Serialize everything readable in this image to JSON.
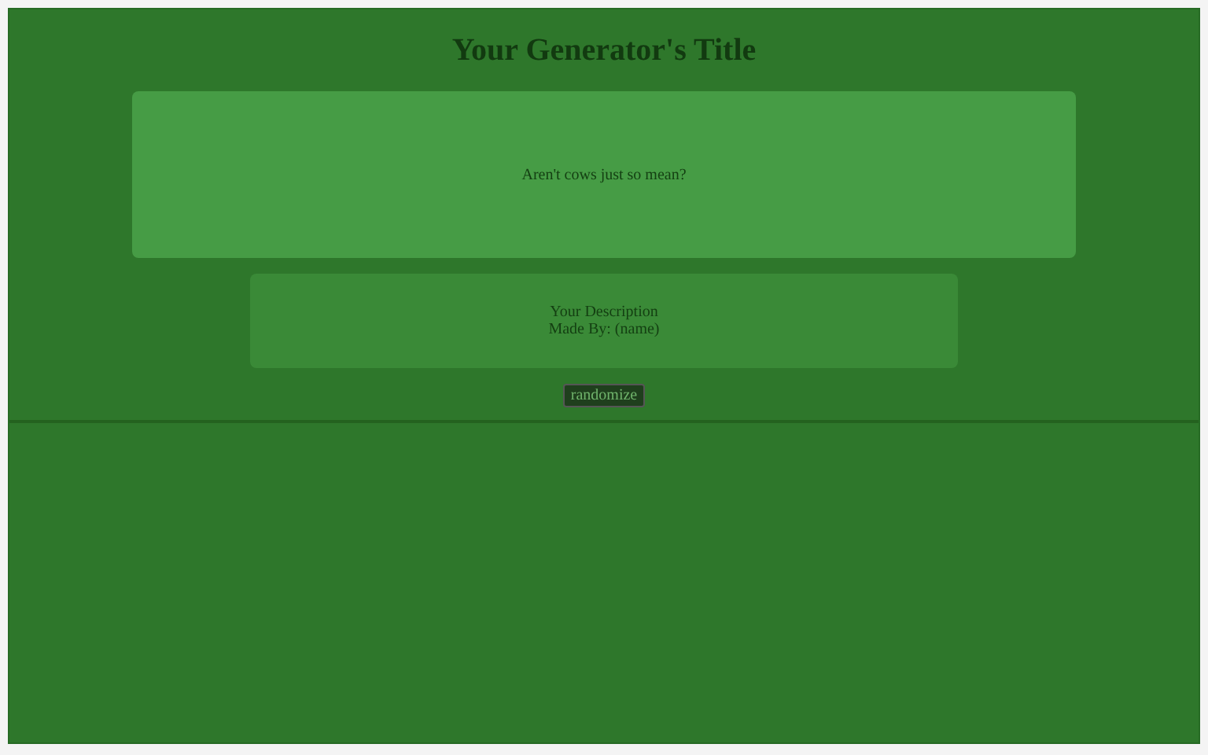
{
  "title": "Your Generator's Title",
  "output": "Aren't cows just so mean?",
  "description": [
    "Your Description",
    "Made By: (name)"
  ],
  "button": "randomize"
}
